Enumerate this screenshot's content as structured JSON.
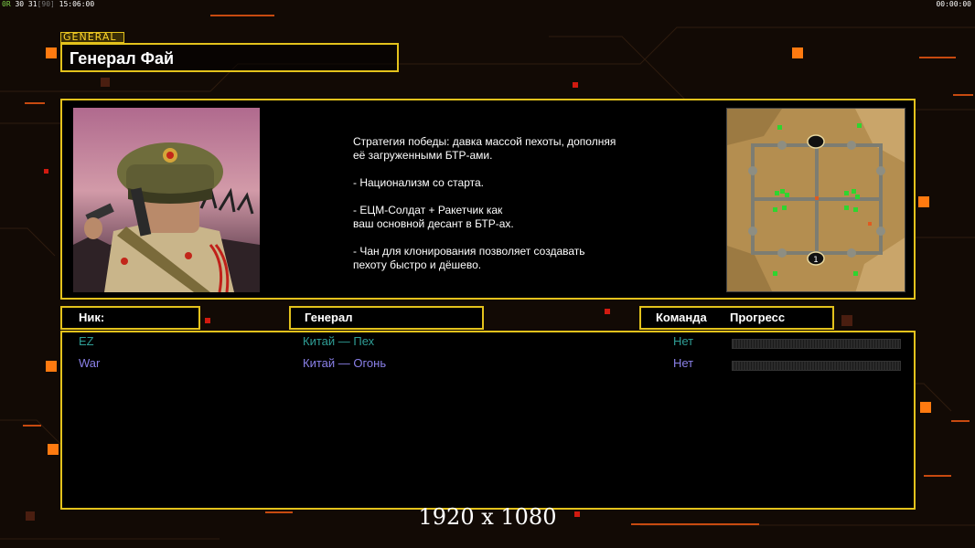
{
  "hud": {
    "left_prefix": "0R",
    "left_values": "30 31",
    "left_bracket": "[90]",
    "left_time": "15:06:00",
    "right_time": "00:00:00"
  },
  "general": {
    "tag": "GENERAL",
    "name": "Генерал Фай",
    "description": "Стратегия победы: давка массой пехоты, дополняя\n её загруженными БТР-ами.\n\n- Национализм со старта.\n\n- ЕЦМ-Солдат + Ракетчик как\nваш основной десант в БТР-ах.\n\n- Чан для клонирования позволяет создавать\n пехоту быстро и дёшево."
  },
  "columns": {
    "nick": "Ник:",
    "general": "Генерал",
    "team": "Команда",
    "progress": "Прогресс"
  },
  "players": [
    {
      "nick": "EZ",
      "general": "Китай — Пех",
      "team": "Нет",
      "color": "#2f9e96",
      "progress": 0
    },
    {
      "nick": "War",
      "general": "Китай — Огонь",
      "team": "Нет",
      "color": "#8a80e8",
      "progress": 0
    }
  ],
  "resolution": "1920 x 1080",
  "colors": {
    "accent": "#e3c21c",
    "orange": "#ff7a10"
  }
}
